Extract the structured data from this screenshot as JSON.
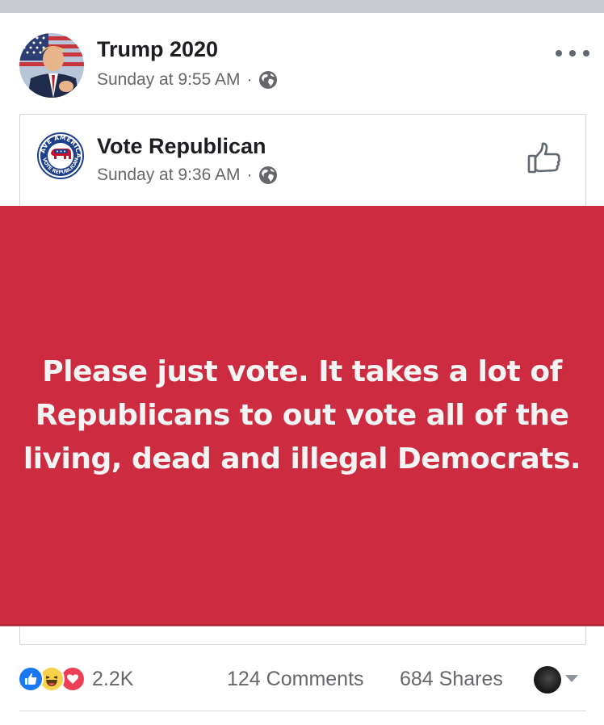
{
  "post": {
    "author": "Trump 2020",
    "timestamp": "Sunday at 9:55 AM",
    "separator": "·",
    "audience_icon": "globe-icon",
    "more_icon": "more-options-icon"
  },
  "shared_post": {
    "page_name": "Vote Republican",
    "timestamp": "Sunday at 9:36 AM",
    "separator": "·",
    "audience_icon": "globe-icon",
    "logo_text_top": "SAVE AMERICA",
    "logo_text_bottom": "VOTE REPUBLICAN",
    "like_page_icon": "thumbs-up-outline-icon",
    "image_text": "Please just vote. It takes a lot of Republicans to out vote all of the living, dead and illegal Democrats.",
    "image_background": "#cd2c40"
  },
  "footer": {
    "reaction_icons": [
      "like-icon",
      "haha-icon",
      "love-icon"
    ],
    "reaction_count": "2.2K",
    "comments": "124 Comments",
    "shares": "684 Shares"
  },
  "colors": {
    "secondary_text": "#65676b",
    "like_blue": "#1877f2",
    "love_red": "#ee3f57",
    "haha_yellow": "#f7d24a"
  }
}
